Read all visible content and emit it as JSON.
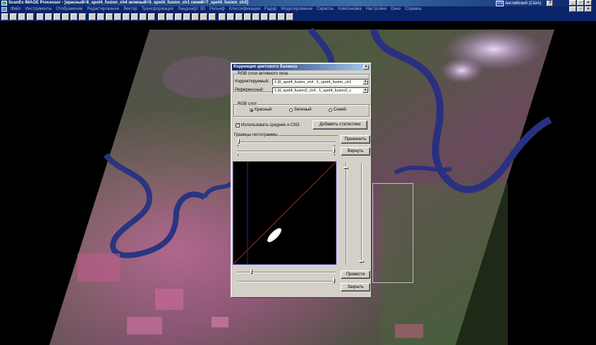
{
  "app": {
    "title": "ScanEx IMAGE Processor - [красный=8_spot4_fusion_ch4 зеленый=5_spot4_fusion_ch1 синий=7_spot4_fusion_ch3]",
    "language": "Английский (США)",
    "lang_code": "EN",
    "help": "?",
    "window_buttons": [
      "_",
      "♂",
      "×"
    ]
  },
  "menu": [
    "Файл",
    "Инструменты",
    "Отображение",
    "Редактирование",
    "Вектор",
    "Трансформация",
    "Ландшафт 3D",
    "Рельеф",
    "Классификация",
    "Радар",
    "Моделирование",
    "Скрипты",
    "Компоновка",
    "Настройки",
    "Окно",
    "Справка"
  ],
  "toolbar": [
    "open-icon",
    "save-icon",
    "layers-icon",
    "print-icon",
    "pan-icon",
    "zoom-in-icon",
    "zoom-out-icon",
    "zoom-box-icon",
    "zoom-full-icon",
    "zoom-fit-icon",
    "ruler-icon",
    "grid-icon",
    "select-icon",
    "frame-icon",
    "info-icon",
    "identify-icon",
    "chart-icon",
    "edit-icon",
    "palette-icon",
    "bar-icon",
    "overview-icon",
    "composite-icon",
    "histogram-icon",
    "contrast-icon",
    "brightness-icon",
    "table-icon",
    "record-icon",
    "crosshair-icon",
    "copy-icon",
    "target-icon",
    "overlay-icon",
    "zoom-layer-icon",
    "refresh-icon",
    "window-icon"
  ],
  "dialog": {
    "title": "Коррекция цветового баланса",
    "close": "×",
    "rgb_group": "RGB слои активного окна",
    "corrected_label": "Корректируемый:",
    "corrected_value": "2.[8_spot4_fusion_ch4 , 5_spot4_fusion_ch1",
    "reference_label": "Референсный:",
    "reference_value": "1.[4_spot4_fusion2_ch4 , 1_spot4_fusion2_c",
    "combo_arrow": "▾",
    "rgb_slot_group": "RGB слот",
    "radio": [
      {
        "label": "Красный",
        "checked": true
      },
      {
        "label": "Зеленый",
        "checked": false
      },
      {
        "label": "Синий",
        "checked": false
      }
    ],
    "use_mean_sko": "Использовать среднее и СКО",
    "use_mean_checked": true,
    "checkmark": "✓",
    "add_stats": "Добавить статистики",
    "hist_bounds": "Границы гистограммы",
    "apply": "Применить",
    "revert": "Вернуть",
    "bring": "Привести",
    "close_btn": "Закрыть",
    "top_slider_1": 0.01,
    "top_slider_2": 0.99,
    "bottom_slider_1": 0.14,
    "bottom_slider_2": 0.99,
    "v_slider_1": 0.04,
    "v_slider_2": 0.98
  }
}
